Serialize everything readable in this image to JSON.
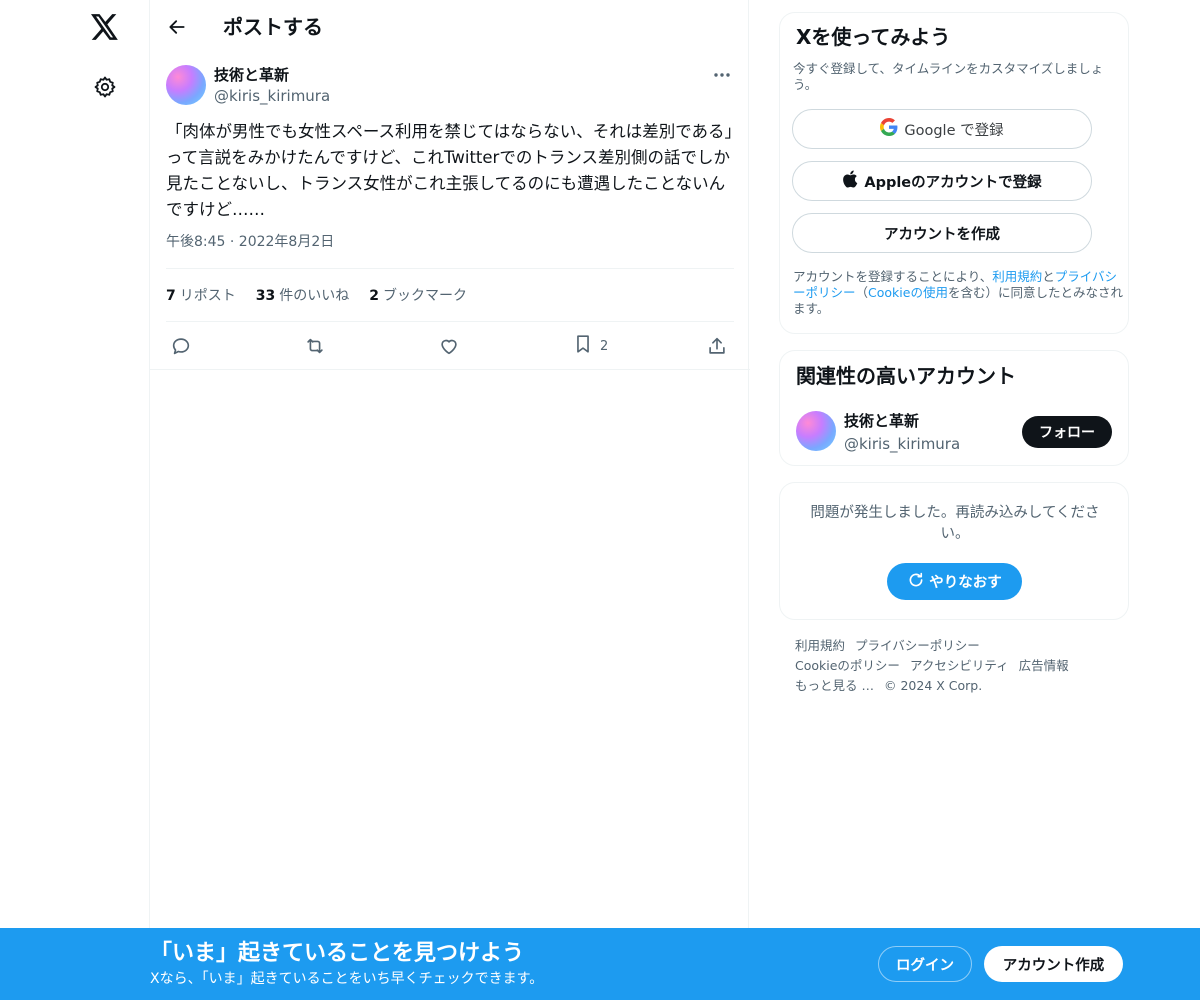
{
  "colors": {
    "accent": "#1d9bf0",
    "text": "#0f1419",
    "muted": "#536471",
    "border": "#eff3f4"
  },
  "nav": {
    "logo_icon": "x-logo-icon",
    "settings_icon": "gear-icon"
  },
  "header": {
    "title": "ポストする"
  },
  "post": {
    "author_name": "技術と革新",
    "author_handle": "@kiris_kirimura",
    "text": "「肉体が男性でも女性スペース利用を禁じてはならない、それは差別である」って言説をみかけたんですけど、これTwitterでのトランス差別側の話でしか見たことないし、トランス女性がこれ主張してるのにも遭遇したことないんですけど……",
    "timestamp": "午後8:45 · 2022年8月2日",
    "stats": {
      "reposts_count": "7",
      "reposts_label": "リポスト",
      "likes_count": "33",
      "likes_label": "件のいいね",
      "bookmarks_count": "2",
      "bookmarks_label": "ブックマーク"
    },
    "actions": {
      "bookmark_count": "2"
    }
  },
  "signup_card": {
    "title": "Xを使ってみよう",
    "subtitle": "今すぐ登録して、タイムラインをカスタマイズしましょう。",
    "google_label": "Google で登録",
    "apple_label": "Appleのアカウントで登録",
    "create_label": "アカウントを作成",
    "terms_prefix": "アカウントを登録することにより、",
    "terms_link": "利用規約",
    "terms_and": "と",
    "privacy_link": "プライバシーポリシー",
    "terms_paren_open": "（",
    "cookie_link": "Cookieの使用",
    "terms_paren_close": "を含む）に同意したとみなされます。"
  },
  "related_card": {
    "title": "関連性の高いアカウント",
    "name": "技術と革新",
    "handle": "@kiris_kirimura",
    "follow_label": "フォロー"
  },
  "error_card": {
    "message": "問題が発生しました。再読み込みしてください。",
    "retry_label": "やりなおす"
  },
  "footer": {
    "links": [
      "利用規約",
      "プライバシーポリシー",
      "Cookieのポリシー",
      "アクセシビリティ",
      "広告情報",
      "もっと見る …"
    ],
    "copyright": "© 2024 X Corp."
  },
  "banner": {
    "title": "「いま」起きていることを見つけよう",
    "subtitle": "Xなら、「いま」起きていることをいち早くチェックできます。",
    "login_label": "ログイン",
    "create_label": "アカウント作成"
  }
}
